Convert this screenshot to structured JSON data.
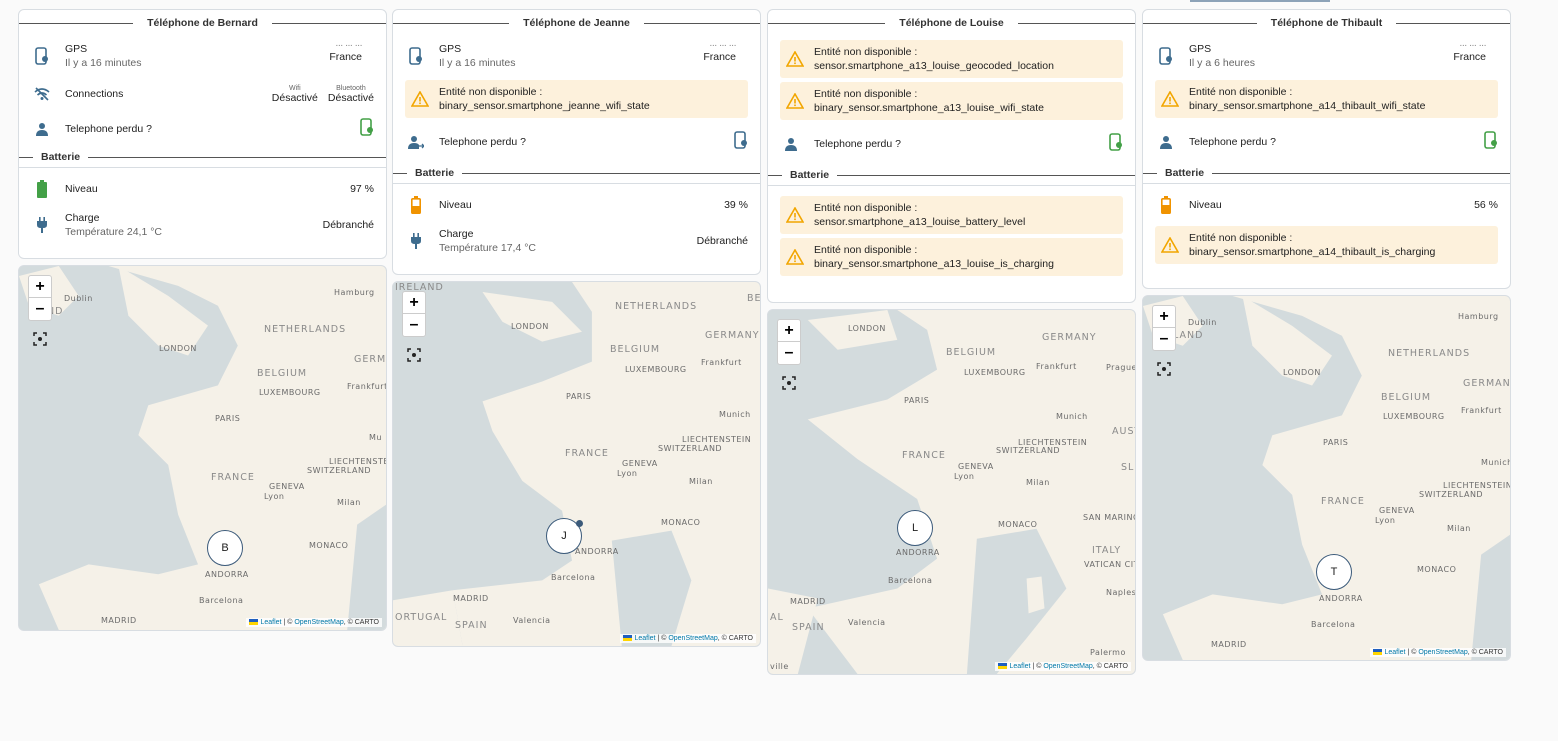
{
  "cards": [
    {
      "title": "Téléphone de Bernard",
      "gps": {
        "label": "GPS",
        "time": "Il y a 16 minutes",
        "addr_line1": "... ... ...",
        "addr_line2": "France"
      },
      "connections": {
        "label": "Connections",
        "wifi_title": "Wifi",
        "wifi_value": "Désactivé",
        "bt_title": "Bluetooth",
        "bt_value": "Désactivé"
      },
      "lost": {
        "label": "Telephone perdu ?"
      },
      "battery_section": "Batterie",
      "level": {
        "label": "Niveau",
        "value": "97 %"
      },
      "charge": {
        "label": "Charge",
        "temp": "Température 24,1 °C",
        "value": "Débranché"
      },
      "marker": "B",
      "map": {
        "zoom_in": "+",
        "zoom_out": "–",
        "attrib_leaflet": "Leaflet",
        "attrib_rest": " | © ",
        "attrib_osm": "OpenStreetMap",
        "attrib_carto": ", © CARTO"
      }
    },
    {
      "title": "Téléphone de Jeanne",
      "gps": {
        "label": "GPS",
        "time": "Il y a 16 minutes",
        "addr_line1": "... ... ...",
        "addr_line2": "France"
      },
      "warn_wifi": {
        "line1": "Entité non disponible :",
        "line2": "binary_sensor.smartphone_jeanne_wifi_state"
      },
      "lost": {
        "label": "Telephone perdu ?"
      },
      "battery_section": "Batterie",
      "level": {
        "label": "Niveau",
        "value": "39 %"
      },
      "charge": {
        "label": "Charge",
        "temp": "Température 17,4 °C",
        "value": "Débranché"
      },
      "marker": "J",
      "map": {
        "zoom_in": "+",
        "zoom_out": "–",
        "attrib_leaflet": "Leaflet",
        "attrib_rest": " | © ",
        "attrib_osm": "OpenStreetMap",
        "attrib_carto": ", © CARTO"
      }
    },
    {
      "title": "Téléphone de Louise",
      "warn_geo": {
        "line1": "Entité non disponible :",
        "line2": "sensor.smartphone_a13_louise_geocoded_location"
      },
      "warn_wifi": {
        "line1": "Entité non disponible :",
        "line2": "binary_sensor.smartphone_a13_louise_wifi_state"
      },
      "lost": {
        "label": "Telephone perdu ?"
      },
      "battery_section": "Batterie",
      "warn_batt": {
        "line1": "Entité non disponible :",
        "line2": "sensor.smartphone_a13_louise_battery_level"
      },
      "warn_charge": {
        "line1": "Entité non disponible :",
        "line2": "binary_sensor.smartphone_a13_louise_is_charging"
      },
      "marker": "L",
      "map": {
        "zoom_in": "+",
        "zoom_out": "–",
        "attrib_leaflet": "Leaflet",
        "attrib_rest": " | © ",
        "attrib_osm": "OpenStreetMap",
        "attrib_carto": ", © CARTO"
      }
    },
    {
      "title": "Téléphone de Thibault",
      "gps": {
        "label": "GPS",
        "time": "Il y a 6 heures",
        "addr_line1": "... ... ...",
        "addr_line2": "France"
      },
      "warn_wifi": {
        "line1": "Entité non disponible :",
        "line2": "binary_sensor.smartphone_a14_thibault_wifi_state"
      },
      "lost": {
        "label": "Telephone perdu ?"
      },
      "battery_section": "Batterie",
      "level": {
        "label": "Niveau",
        "value": "56 %"
      },
      "warn_charge": {
        "line1": "Entité non disponible :",
        "line2": "binary_sensor.smartphone_a14_thibault_is_charging"
      },
      "marker": "T",
      "map": {
        "zoom_in": "+",
        "zoom_out": "–",
        "attrib_leaflet": "Leaflet",
        "attrib_rest": " | © ",
        "attrib_osm": "OpenStreetMap",
        "attrib_carto": ", © CARTO"
      }
    }
  ],
  "map_labels": {
    "ireland": "IRELAND",
    "dublin": "Dublin",
    "london": "LONDON",
    "netherlands": "NETHERLANDS",
    "germany": "GERMANY",
    "belgium": "BELGIUM",
    "luxembourg": "LUXEMBOURG",
    "paris": "PARIS",
    "france": "FRANCE",
    "switzerland": "SWITZERLAND",
    "liechtenstein": "LIECHTENSTEIN",
    "geneva": "GENEVA",
    "lyon": "Lyon",
    "milan": "Milan",
    "monaco": "MONACO",
    "andorra": "ANDORRA",
    "barcelona": "Barcelona",
    "madrid": "MADRID",
    "spain": "SPAIN",
    "hamburg": "Hamburg",
    "frankfurt": "Frankfurt",
    "munich": "Munich",
    "valencia": "Valencia",
    "portugal": "ORTUGAL",
    "italy": "ITALY",
    "vatican": "VATICAN CITY",
    "san_marino": "SAN MARINO",
    "naples": "Naples",
    "palermo": "Palermo",
    "prague": "Prague",
    "mu": "Mu",
    "germ": "GERM",
    "aust": "AUST",
    "be": "BE",
    "al": "AL",
    "sl": "SL",
    "seville": "ville",
    "land": "LAND"
  },
  "colors": {
    "warning_bg": "#fdf1dc",
    "warning_icon": "#f2a600",
    "green": "#43a047",
    "orange": "#f09300",
    "blue_icon": "#3e6c8e"
  }
}
